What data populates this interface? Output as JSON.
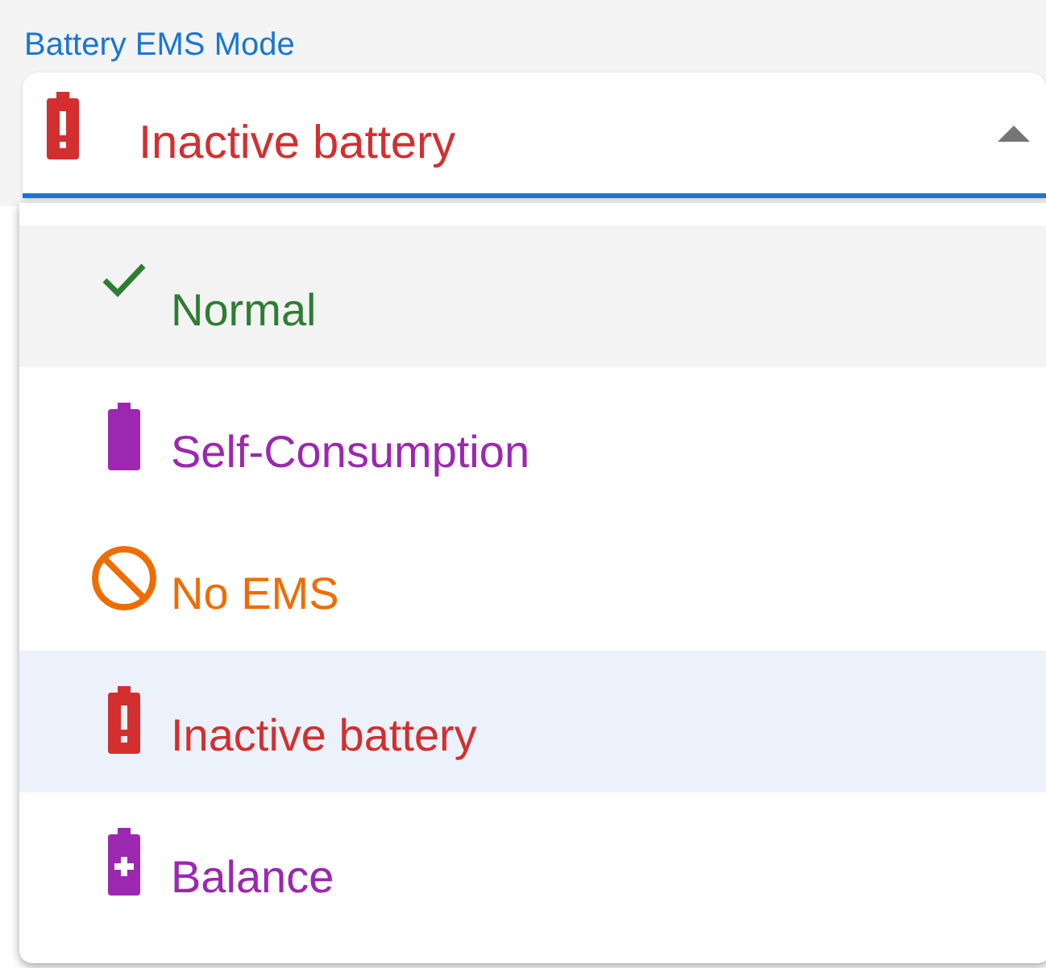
{
  "field": {
    "label": "Battery EMS Mode",
    "value": "Inactive battery",
    "kind": "battery-alert",
    "color": "#d32f2f",
    "expanded": true
  },
  "options": [
    {
      "label": "Normal",
      "kind": "check",
      "color": "#2e7d32",
      "selected": false,
      "highlighted": true
    },
    {
      "label": "Self-Consumption",
      "kind": "battery",
      "color": "#9c27b0",
      "selected": false,
      "highlighted": false
    },
    {
      "label": "No EMS",
      "kind": "block",
      "color": "#ef6c00",
      "selected": false,
      "highlighted": false
    },
    {
      "label": "Inactive battery",
      "kind": "battery-alert",
      "color": "#d32f2f",
      "selected": true,
      "highlighted": false
    },
    {
      "label": "Balance",
      "kind": "battery-plus",
      "color": "#9c27b0",
      "selected": false,
      "highlighted": false
    }
  ]
}
